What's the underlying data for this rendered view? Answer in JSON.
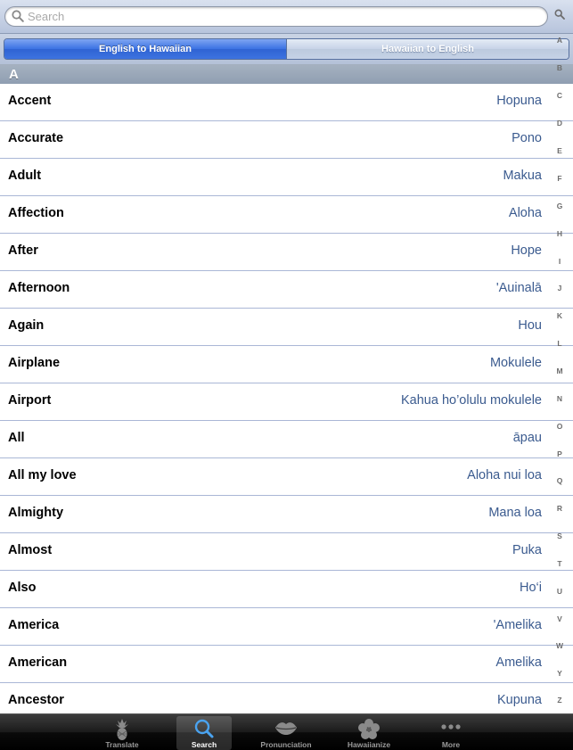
{
  "search": {
    "placeholder": "Search"
  },
  "segmented_control": {
    "options": [
      "English to Hawaiian",
      "Hawaiian to English"
    ],
    "selected": "English to Hawaiian"
  },
  "section": {
    "title": "A"
  },
  "entries": [
    {
      "english": "Accent",
      "hawaiian": "Hopuna"
    },
    {
      "english": "Accurate",
      "hawaiian": "Pono"
    },
    {
      "english": "Adult",
      "hawaiian": "Makua"
    },
    {
      "english": "Affection",
      "hawaiian": "Aloha"
    },
    {
      "english": "After",
      "hawaiian": "Hope"
    },
    {
      "english": "Afternoon",
      "hawaiian": "'Auinalā"
    },
    {
      "english": "Again",
      "hawaiian": "Hou"
    },
    {
      "english": "Airplane",
      "hawaiian": "Mokulele"
    },
    {
      "english": "Airport",
      "hawaiian": "Kahua ho’olulu mokulele"
    },
    {
      "english": "All",
      "hawaiian": "āpau"
    },
    {
      "english": "All my love",
      "hawaiian": "Aloha nui loa"
    },
    {
      "english": "Almighty",
      "hawaiian": "Mana loa"
    },
    {
      "english": "Almost",
      "hawaiian": "Puka"
    },
    {
      "english": "Also",
      "hawaiian": "Ho‘i"
    },
    {
      "english": "America",
      "hawaiian": "'Amelika"
    },
    {
      "english": "American",
      "hawaiian": "Amelika"
    },
    {
      "english": "Ancestor",
      "hawaiian": "Kupuna"
    }
  ],
  "index": {
    "search_icon": "search-icon",
    "letters": [
      "A",
      "B",
      "C",
      "D",
      "E",
      "F",
      "G",
      "H",
      "I",
      "J",
      "K",
      "L",
      "M",
      "N",
      "O",
      "P",
      "Q",
      "R",
      "S",
      "T",
      "U",
      "V",
      "W",
      "Y",
      "Z"
    ]
  },
  "tab_bar": {
    "selected": "Search",
    "tabs": [
      {
        "label": "Translate",
        "icon": "pineapple-icon"
      },
      {
        "label": "Search",
        "icon": "search-icon"
      },
      {
        "label": "Pronunciation",
        "icon": "lips-icon"
      },
      {
        "label": "Hawaiianize",
        "icon": "hibiscus-icon"
      },
      {
        "label": "More",
        "icon": "more-icon"
      }
    ]
  },
  "colors": {
    "english_text": "#000000",
    "hawaiian_text": "#3b5b8f",
    "segment_active": "#3b72e3",
    "row_separator": "#aab7d6"
  }
}
